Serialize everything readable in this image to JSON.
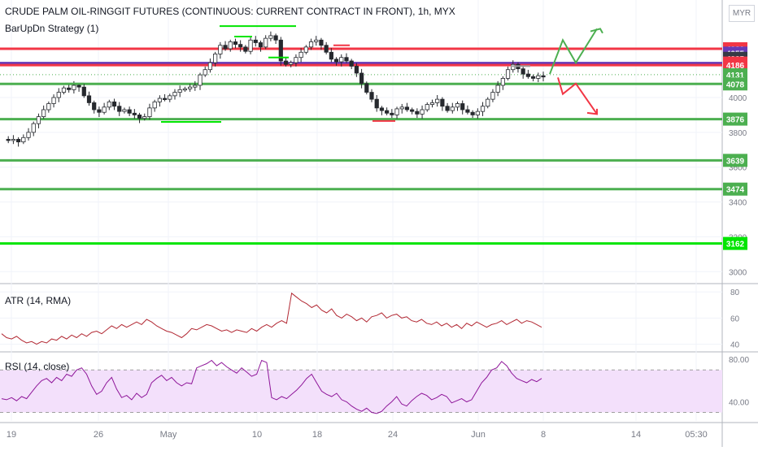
{
  "header": {
    "title": "CRUDE PALM OIL-RINGGIT FUTURES (CONTINUOUS: CURRENT CONTRACT IN FRONT), 1h, MYX",
    "strategy": "BarUpDn Strategy (1)",
    "currency": "MYR"
  },
  "panes": {
    "atr_label": "ATR (14, RMA)",
    "rsi_label": "RSI (14, close)"
  },
  "chart_data": [
    {
      "type": "candlestick",
      "pane": "price",
      "ylim": [
        2950,
        4420
      ],
      "y_ticks": [
        3000,
        3200,
        3400,
        3600,
        3800,
        4000
      ],
      "x_ticks": [
        "19",
        "26",
        "May",
        "10",
        "18",
        "24",
        "Jun",
        "8",
        "14",
        "05:30"
      ],
      "price_levels": [
        {
          "label": "4280",
          "value": 4280,
          "color": "#f23645"
        },
        {
          "label": "4255",
          "value": 4255,
          "color": "#673ab7"
        },
        {
          "label": "4225",
          "value": 4225,
          "color": "#363a45"
        },
        {
          "label": "4198",
          "value": 4198,
          "color": "#f23645"
        },
        {
          "label": "4186",
          "value": 4186,
          "color": "#f23645"
        },
        {
          "label": "4131",
          "value": 4131,
          "color": "#4caf50"
        },
        {
          "label": "4078",
          "value": 4078,
          "color": "#4caf50"
        },
        {
          "label": "3876",
          "value": 3876,
          "color": "#4caf50"
        },
        {
          "label": "3639",
          "value": 3639,
          "color": "#4caf50"
        },
        {
          "label": "3474",
          "value": 3474,
          "color": "#4caf50"
        },
        {
          "label": "3162",
          "value": 3162,
          "color": "#00e500"
        }
      ],
      "horizontal_lines": [
        {
          "value": 4280,
          "color": "#f23645"
        },
        {
          "value": 4198,
          "color": "#673ab7"
        },
        {
          "value": 4186,
          "color": "#f23645"
        },
        {
          "value": 4078,
          "color": "#4caf50"
        },
        {
          "value": 3876,
          "color": "#4caf50"
        },
        {
          "value": 3639,
          "color": "#4caf50"
        },
        {
          "value": 3474,
          "color": "#4caf50"
        },
        {
          "value": 3162,
          "color": "#00e500"
        }
      ],
      "path_points": [
        3760,
        3755,
        3760,
        3745,
        3770,
        3800,
        3850,
        3890,
        3930,
        3965,
        4000,
        4030,
        4055,
        4045,
        4070,
        4060,
        4010,
        3970,
        3930,
        3915,
        3945,
        3975,
        3950,
        3920,
        3930,
        3910,
        3900,
        3880,
        3890,
        3940,
        3975,
        3995,
        3990,
        4010,
        4030,
        4045,
        4050,
        4060,
        4070,
        4130,
        4160,
        4200,
        4250,
        4300,
        4280,
        4320,
        4305,
        4290,
        4265,
        4330,
        4315,
        4290,
        4340,
        4355,
        4330,
        4210,
        4190,
        4200,
        4230,
        4260,
        4290,
        4320,
        4330,
        4300,
        4260,
        4220,
        4205,
        4230,
        4210,
        4180,
        4140,
        4080,
        4030,
        3990,
        3940,
        3925,
        3910,
        3900,
        3935,
        3945,
        3930,
        3920,
        3905,
        3930,
        3960,
        3970,
        3990,
        3950,
        3925,
        3945,
        3965,
        3930,
        3915,
        3900,
        3920,
        3950,
        3990,
        4030,
        4070,
        4110,
        4160,
        4190,
        4165,
        4135,
        4120,
        4110,
        4125,
        4120
      ],
      "projection_colors": {
        "up": "#4caf50",
        "down": "#f23645"
      }
    },
    {
      "type": "line",
      "pane": "atr",
      "name": "ATR (14, RMA)",
      "color": "#b22833",
      "ylim": [
        36,
        82
      ],
      "y_ticks": [
        80,
        60,
        40
      ],
      "values": [
        48,
        45,
        44,
        46,
        43,
        41,
        42,
        40,
        42,
        41,
        44,
        43,
        46,
        44,
        47,
        45,
        48,
        46,
        49,
        50,
        48,
        51,
        54,
        52,
        55,
        53,
        55,
        57,
        55,
        59,
        57,
        54,
        52,
        50,
        49,
        47,
        45,
        48,
        52,
        51,
        53,
        55,
        54,
        52,
        50,
        51,
        49,
        51,
        50,
        49,
        52,
        50,
        53,
        55,
        53,
        56,
        58,
        56,
        79,
        76,
        73,
        71,
        68,
        70,
        66,
        64,
        67,
        62,
        60,
        63,
        61,
        58,
        60,
        57,
        61,
        62,
        64,
        60,
        62,
        63,
        60,
        61,
        58,
        57,
        59,
        56,
        55,
        57,
        54,
        56,
        53,
        55,
        52,
        56,
        54,
        57,
        55,
        53,
        55,
        56,
        58,
        55,
        57,
        59,
        56,
        58,
        57,
        55,
        53
      ]
    },
    {
      "type": "line",
      "pane": "rsi",
      "name": "RSI (14, close)",
      "color": "#8e1599",
      "ylim": [
        22,
        84
      ],
      "y_ticks": [
        80,
        40
      ],
      "bands": [
        70,
        30
      ],
      "values": [
        43,
        42,
        44,
        41,
        45,
        43,
        49,
        55,
        60,
        62,
        58,
        63,
        60,
        66,
        64,
        70,
        72,
        66,
        55,
        47,
        50,
        58,
        63,
        52,
        44,
        46,
        42,
        48,
        44,
        47,
        58,
        62,
        65,
        60,
        63,
        58,
        55,
        58,
        57,
        72,
        74,
        76,
        79,
        74,
        77,
        73,
        70,
        67,
        72,
        68,
        64,
        66,
        79,
        77,
        44,
        42,
        45,
        43,
        47,
        51,
        56,
        62,
        66,
        58,
        50,
        47,
        45,
        48,
        42,
        40,
        36,
        33,
        31,
        34,
        30,
        29,
        31,
        36,
        40,
        45,
        38,
        36,
        41,
        45,
        48,
        46,
        42,
        44,
        47,
        45,
        39,
        41,
        43,
        40,
        42,
        50,
        58,
        63,
        70,
        72,
        78,
        74,
        67,
        62,
        60,
        58,
        61,
        59,
        62
      ]
    }
  ]
}
